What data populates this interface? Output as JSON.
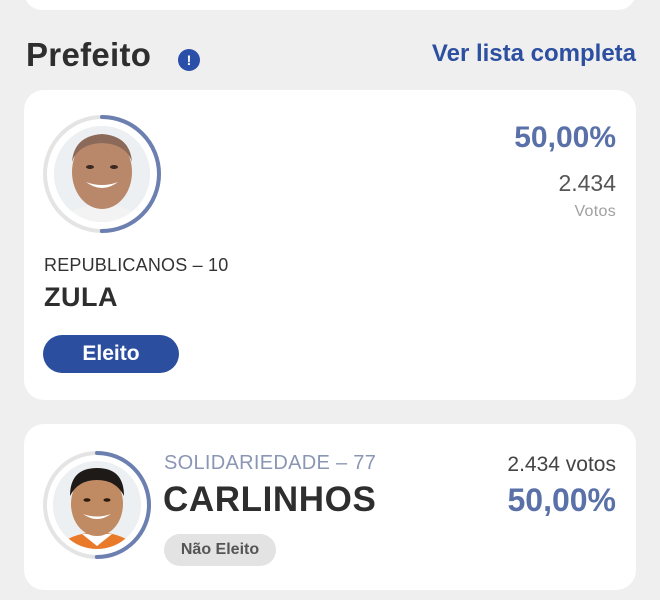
{
  "section": {
    "title": "Prefeito",
    "info_icon": "info-icon",
    "view_all": "Ver lista completa"
  },
  "candidates": [
    {
      "party": "REPUBLICANOS – 10",
      "name": "ZULA",
      "percent": "50,00%",
      "votes": "2.434",
      "votes_label": "Votos",
      "status": "Eleito",
      "progress_fraction": 0.5
    },
    {
      "party": "SOLIDARIEDADE – 77",
      "name": "CARLINHOS",
      "percent": "50,00%",
      "votes": "2.434 votos",
      "status": "Não Eleito",
      "progress_fraction": 0.5
    }
  ],
  "colors": {
    "accent": "#2b4f9e",
    "percent": "#5a70a8",
    "progress": "#6b7fb0"
  }
}
